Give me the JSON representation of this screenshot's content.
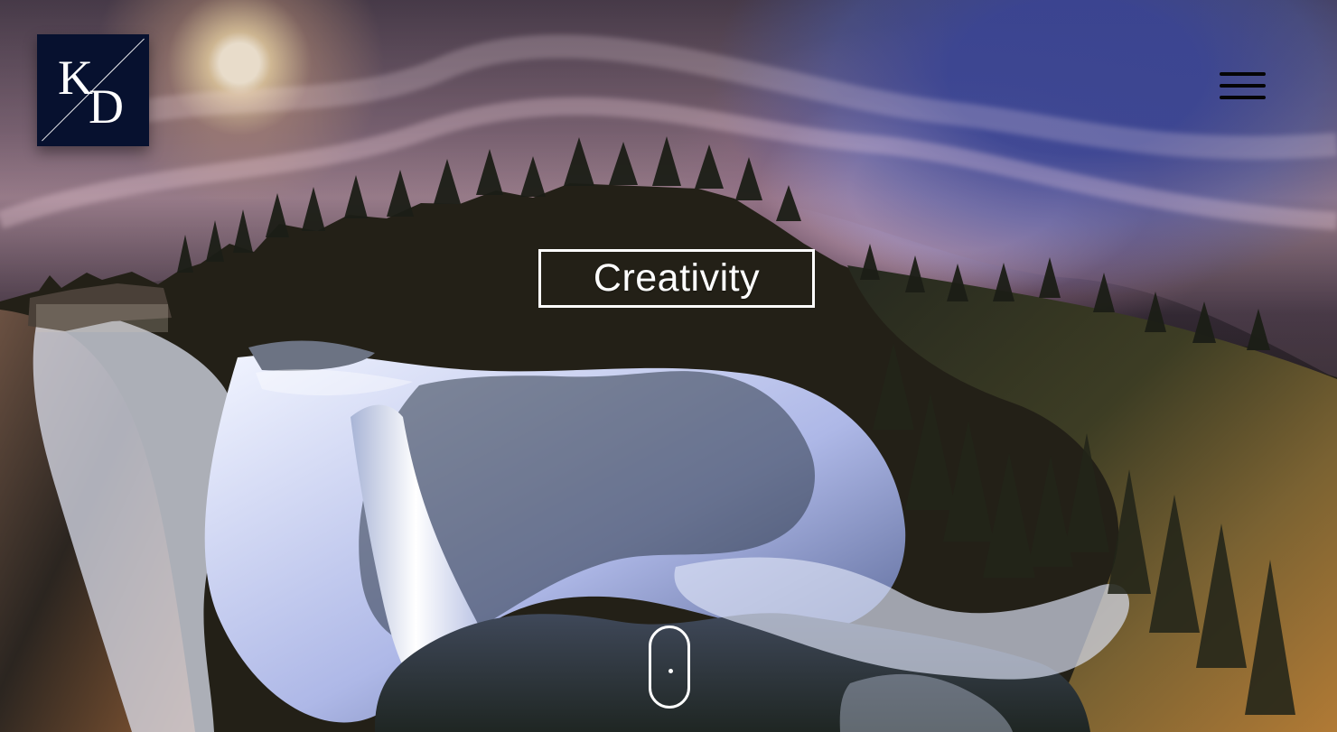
{
  "logo": {
    "left_letter": "K",
    "right_letter": "D",
    "background_color": "#07112f",
    "foreground_color": "#ffffff"
  },
  "header": {
    "menu_icon": "hamburger-menu-icon"
  },
  "hero": {
    "headline": "Creativity",
    "scroll_icon": "mouse-scroll-icon",
    "accent_color": "#ffffff"
  }
}
